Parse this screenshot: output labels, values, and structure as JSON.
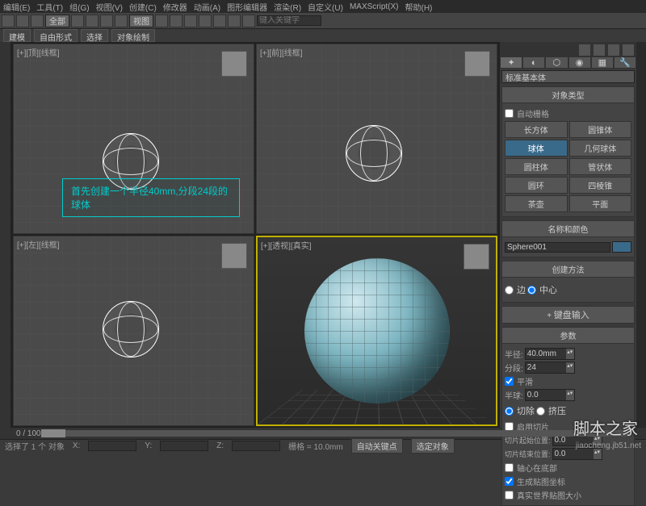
{
  "menu": {
    "items": [
      "编辑(E)",
      "工具(T)",
      "组(G)",
      "视图(V)",
      "创建(C)",
      "修改器",
      "动画(A)",
      "图形编辑器",
      "渲染(R)",
      "自定义(U)",
      "MAXScript(X)",
      "帮助(H)"
    ]
  },
  "toolbar": {
    "layerDropdown": "全部",
    "viewDropdown": "视图",
    "searchPlaceholder": "键入关键字"
  },
  "tabs": {
    "items": [
      "建模",
      "自由形式",
      "选择",
      "对象绘制"
    ]
  },
  "viewports": {
    "topLeft": {
      "label": "[+][顶][线框]"
    },
    "topRight": {
      "label": "[+][前][线框]"
    },
    "bottomLeft": {
      "label": "[+][左][线框]"
    },
    "bottomRight": {
      "label": "[+][透视][真实]"
    }
  },
  "annotation": {
    "text": "首先创建一个半径40mm,分段24段的球体"
  },
  "cmd": {
    "category": "标准基本体",
    "roll_objtype": "对象类型",
    "autogrid": "自动栅格",
    "types": [
      [
        "长方体",
        "圆锥体"
      ],
      [
        "球体",
        "几何球体"
      ],
      [
        "圆柱体",
        "管状体"
      ],
      [
        "圆环",
        "四棱锥"
      ],
      [
        "茶壶",
        "平面"
      ]
    ],
    "selectedType": "球体",
    "roll_name": "名称和颜色",
    "objName": "Sphere001",
    "roll_method": "创建方法",
    "method_edge": "边",
    "method_center": "中心",
    "roll_kbd": "键盘输入",
    "roll_params": "参数",
    "radius_lbl": "半径:",
    "radius": "40.0mm",
    "segs_lbl": "分段:",
    "segs": "24",
    "smooth": "平滑",
    "hemi_lbl": "半球:",
    "hemi": "0.0",
    "chop": "切除",
    "squash": "挤压",
    "sliceOn": "启用切片",
    "sliceFrom_lbl": "切片起始位置:",
    "sliceFrom": "0.0",
    "sliceTo_lbl": "切片结束位置:",
    "sliceTo": "0.0",
    "basePivot": "轴心在底部",
    "genUV": "生成贴图坐标",
    "realWorld": "真实世界贴图大小"
  },
  "timeline": {
    "range": "0 / 100"
  },
  "status": {
    "selection": "选择了 1 个 对象",
    "x": "X:",
    "y": "Y:",
    "z": "Z:",
    "grid": "栅格 = 10.0mm",
    "autokey": "自动关键点",
    "selobj": "选定对象"
  },
  "watermark": {
    "main": "脚本之家",
    "sub": "jiaocheng.jb51.net"
  }
}
